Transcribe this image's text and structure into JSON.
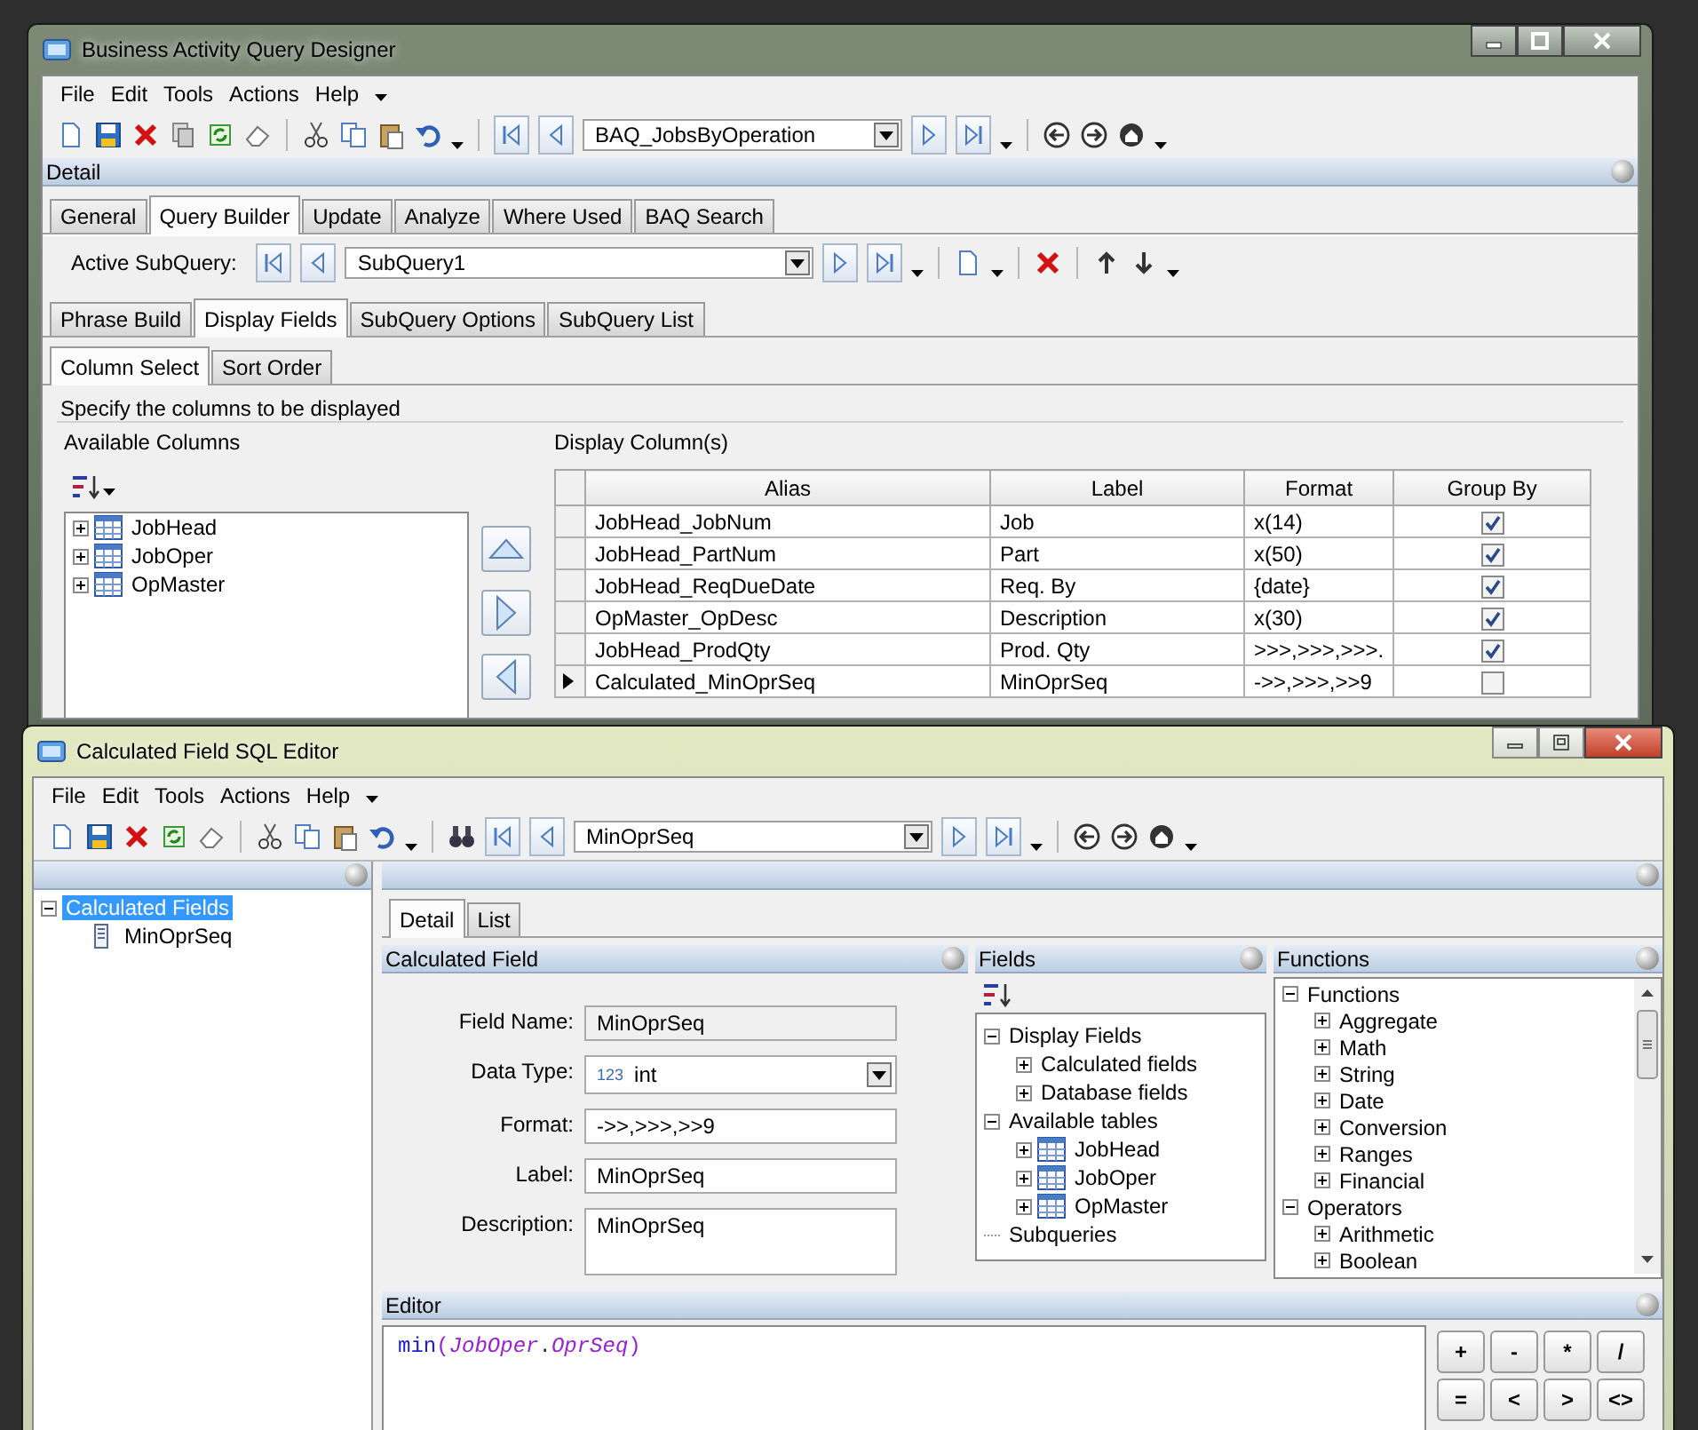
{
  "designer": {
    "title": "Business Activity Query Designer",
    "menu": [
      "File",
      "Edit",
      "Tools",
      "Actions",
      "Help"
    ],
    "record": "BAQ_JobsByOperation",
    "detail_header": "Detail",
    "tabs": [
      {
        "label": "General",
        "selected": false
      },
      {
        "label": "Query Builder",
        "selected": true
      },
      {
        "label": "Update",
        "selected": false
      },
      {
        "label": "Analyze",
        "selected": false
      },
      {
        "label": "Where Used",
        "selected": false
      },
      {
        "label": "BAQ Search",
        "selected": false
      }
    ],
    "subquery": {
      "label": "Active SubQuery:",
      "value": "SubQuery1"
    },
    "subquery_tabs": [
      {
        "label": "Phrase Build",
        "selected": false
      },
      {
        "label": "Display Fields",
        "selected": true
      },
      {
        "label": "SubQuery Options",
        "selected": false
      },
      {
        "label": "SubQuery List",
        "selected": false
      }
    ],
    "display_tabs": [
      {
        "label": "Column Select",
        "selected": true
      },
      {
        "label": "Sort Order",
        "selected": false
      }
    ],
    "group_title": "Specify the columns to be displayed",
    "available_title": "Available Columns",
    "available_tree": [
      {
        "label": "JobHead",
        "kind": "table",
        "expanded": false
      },
      {
        "label": "JobOper",
        "kind": "table",
        "expanded": false
      },
      {
        "label": "OpMaster",
        "kind": "table",
        "expanded": false
      }
    ],
    "display_title": "Display Column(s)",
    "grid": {
      "columns": [
        "Alias",
        "Label",
        "Format",
        "Group By"
      ],
      "rows": [
        {
          "alias": "JobHead_JobNum",
          "label": "Job",
          "format": "x(14)",
          "group_by": true,
          "current": false
        },
        {
          "alias": "JobHead_PartNum",
          "label": "Part",
          "format": "x(50)",
          "group_by": true,
          "current": false
        },
        {
          "alias": "JobHead_ReqDueDate",
          "label": "Req. By",
          "format": "{date}",
          "group_by": true,
          "current": false
        },
        {
          "alias": "OpMaster_OpDesc",
          "label": "Description",
          "format": "x(30)",
          "group_by": true,
          "current": false
        },
        {
          "alias": "JobHead_ProdQty",
          "label": "Prod. Qty",
          "format": ">>>,>>>,>>>.",
          "group_by": true,
          "current": false
        },
        {
          "alias": "Calculated_MinOprSeq",
          "label": "MinOprSeq",
          "format": "->>,>>>,>>9",
          "group_by": false,
          "current": true
        }
      ]
    }
  },
  "editor": {
    "title": "Calculated Field SQL Editor",
    "menu": [
      "File",
      "Edit",
      "Tools",
      "Actions",
      "Help"
    ],
    "record": "MinOprSeq",
    "tree": [
      {
        "label": "Calculated Fields",
        "expanded": true,
        "selected": true,
        "children": [
          {
            "label": "MinOprSeq",
            "kind": "field",
            "selected": false
          }
        ]
      }
    ],
    "tabs": [
      {
        "label": "Detail",
        "selected": true
      },
      {
        "label": "List",
        "selected": false
      }
    ],
    "calculated_field": {
      "header": "Calculated Field",
      "fields": [
        {
          "label": "Field Name:",
          "value": "MinOprSeq",
          "kind": "readonly"
        },
        {
          "label": "Data Type:",
          "value": "int",
          "badge": "123",
          "kind": "combo"
        },
        {
          "label": "Format:",
          "value": "->>,>>>,>>9",
          "kind": "text"
        },
        {
          "label": "Label:",
          "value": "MinOprSeq",
          "kind": "text"
        },
        {
          "label": "Description:",
          "value": "MinOprSeq",
          "kind": "memo"
        }
      ]
    },
    "fields": {
      "header": "Fields",
      "tree": [
        {
          "label": "Display Fields",
          "expanded": true,
          "children": [
            {
              "label": "Calculated fields",
              "expanded": false
            },
            {
              "label": "Database fields",
              "expanded": false
            }
          ]
        },
        {
          "label": "Available tables",
          "expanded": true,
          "children": [
            {
              "label": "JobHead",
              "kind": "table",
              "expanded": false
            },
            {
              "label": "JobOper",
              "kind": "table",
              "expanded": false
            },
            {
              "label": "OpMaster",
              "kind": "table",
              "expanded": false
            }
          ]
        },
        {
          "label": "Subqueries"
        }
      ]
    },
    "functions": {
      "header": "Functions",
      "tree": [
        {
          "label": "Functions",
          "expanded": true,
          "children": [
            {
              "label": "Aggregate",
              "expanded": false
            },
            {
              "label": "Math",
              "expanded": false
            },
            {
              "label": "String",
              "expanded": false
            },
            {
              "label": "Date",
              "expanded": false
            },
            {
              "label": "Conversion",
              "expanded": false
            },
            {
              "label": "Ranges",
              "expanded": false
            },
            {
              "label": "Financial",
              "expanded": false
            }
          ]
        },
        {
          "label": "Operators",
          "expanded": true,
          "children": [
            {
              "label": "Arithmetic",
              "expanded": false
            },
            {
              "label": "Boolean",
              "expanded": false
            }
          ]
        }
      ]
    },
    "editor_panel": {
      "header": "Editor",
      "code": [
        {
          "text": "min",
          "kind": "function"
        },
        {
          "text": "(",
          "kind": "paren"
        },
        {
          "text": "JobOper",
          "kind": "table"
        },
        {
          "text": ".",
          "kind": "dot"
        },
        {
          "text": "OprSeq",
          "kind": "field"
        },
        {
          "text": ")",
          "kind": "paren"
        }
      ]
    },
    "operators": [
      "+",
      "-",
      "*",
      "/",
      "=",
      "<",
      ">",
      "<>"
    ]
  }
}
